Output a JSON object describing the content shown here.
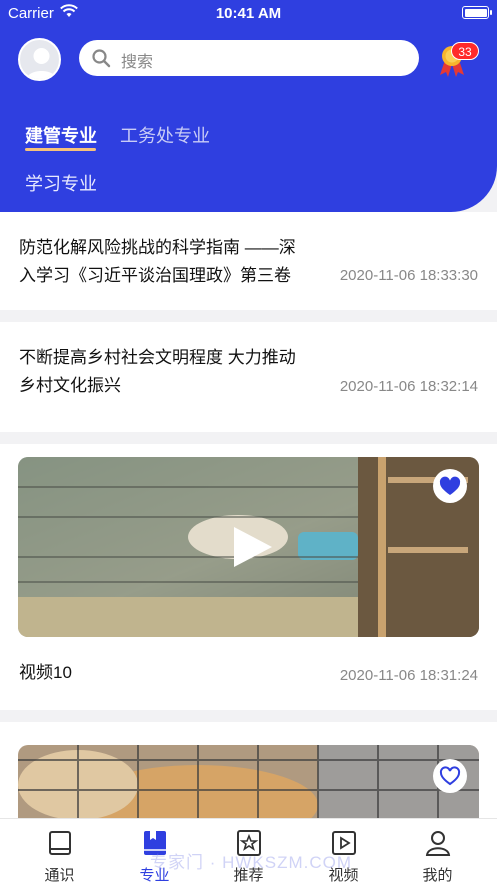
{
  "status_bar": {
    "carrier": "Carrier",
    "time": "10:41 AM"
  },
  "search": {
    "placeholder": "搜索"
  },
  "medal": {
    "badge_count": "33"
  },
  "tabs": [
    {
      "label": "建管专业",
      "active": true
    },
    {
      "label": "工务处专业",
      "active": false
    },
    {
      "label": "学习专业",
      "active": false
    }
  ],
  "articles": [
    {
      "title_line1": "防范化解风险挑战的科学指南 ——深",
      "title_line2": "入学习《习近平谈治国理政》第三卷",
      "date": "2020-11-06 18:33:30"
    },
    {
      "title_line1": "不断提高乡村社会文明程度 大力推动",
      "title_line2": "乡村文化振兴",
      "date": "2020-11-06 18:32:14"
    }
  ],
  "videos": [
    {
      "title": "视频10",
      "date": "2020-11-06 18:31:24",
      "favorited": true
    }
  ],
  "video_next": {
    "favorited": false
  },
  "tabbar": {
    "items": [
      {
        "label": "通识",
        "icon": "book-icon"
      },
      {
        "label": "专业",
        "icon": "bookmark-book-icon",
        "active": true
      },
      {
        "label": "推荐",
        "icon": "star-icon"
      },
      {
        "label": "视频",
        "icon": "play-icon"
      },
      {
        "label": "我的",
        "icon": "user-icon"
      }
    ]
  },
  "watermark": "专家门 · HWKSZM.COM",
  "colors": {
    "primary": "#2f3fe0",
    "tab_underline": "#f6c27b",
    "badge": "#ff2a2a"
  }
}
